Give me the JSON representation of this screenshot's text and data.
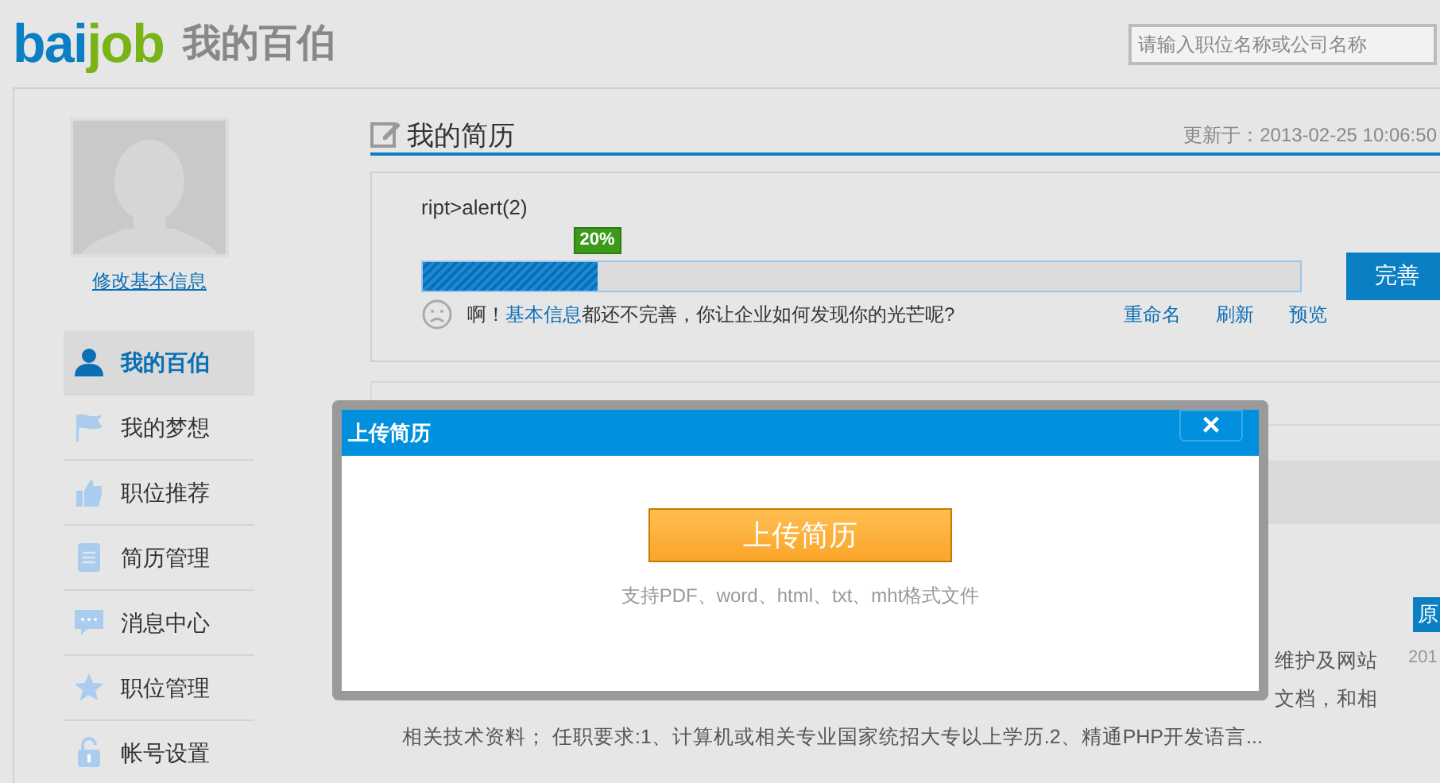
{
  "header": {
    "logo": [
      {
        "text": "bai",
        "color": "#0a7fc3"
      },
      {
        "text": "job",
        "color": "#7ab317"
      }
    ],
    "site_title": "我的百伯",
    "search": {
      "placeholder": "请输入职位名称或公司名称"
    }
  },
  "sidebar": {
    "edit_link": "修改基本信息",
    "items": [
      {
        "label": "我的百伯",
        "selected": true
      },
      {
        "label": "我的梦想",
        "selected": false
      },
      {
        "label": "职位推荐",
        "selected": false
      },
      {
        "label": "简历管理",
        "selected": false
      },
      {
        "label": "消息中心",
        "selected": false
      },
      {
        "label": "职位管理",
        "selected": false
      },
      {
        "label": "帐号设置",
        "selected": false
      }
    ]
  },
  "resume": {
    "title": "我的简历",
    "updated": "更新于：2013-02-25 10:06:50",
    "name": "ript>alert(2)",
    "progress": {
      "label": "20%",
      "level": 0.2
    },
    "complete_button": "完善",
    "hint": [
      {
        "text": "啊！",
        "link": false
      },
      {
        "text": "基本信息",
        "link": true
      },
      {
        "text": "都还不完善，你让企业如何发现你的光芒呢?",
        "link": false
      }
    ],
    "actions": [
      "重命名",
      "刷新",
      "预览"
    ]
  },
  "job": {
    "badge": "原",
    "date": "201",
    "description_lines": [
      "维护及网站",
      "文档，和相",
      "相关技术资料； 任职要求:1、计算机或相关专业国家统招大专以上学历.2、精通PHP开发语言..."
    ]
  },
  "dialog": {
    "title": "上传简历",
    "close": "×",
    "upload_button": "上传简历",
    "formats": "支持PDF、word、html、txt、mht格式文件"
  }
}
